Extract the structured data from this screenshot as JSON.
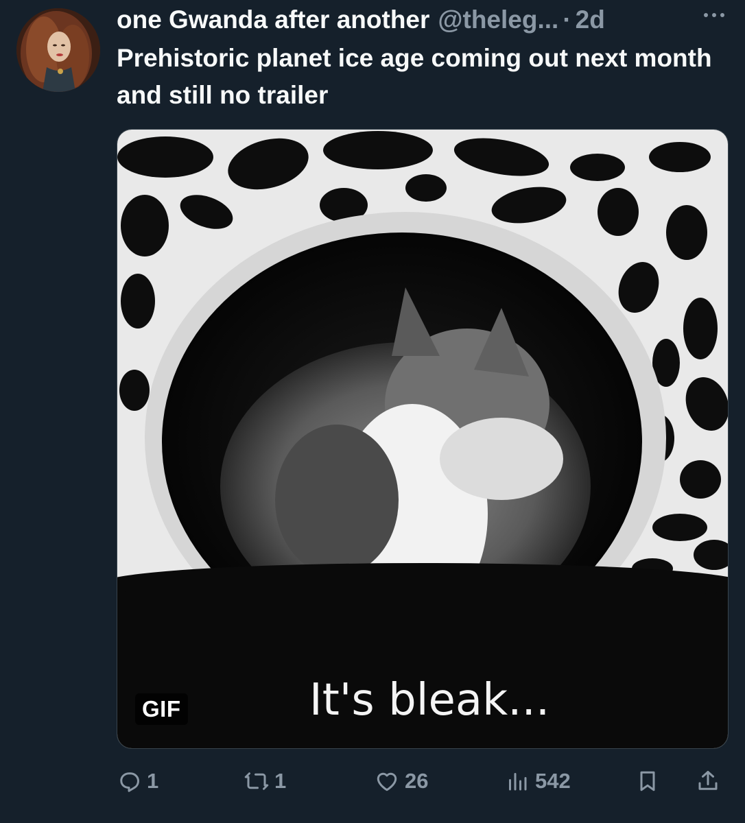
{
  "tweet": {
    "display_name": "one Gwanda after another",
    "handle": "@theleg...",
    "separator": "·",
    "time": "2d",
    "text": "Prehistoric planet ice age coming out next month and still no trailer",
    "avatar_icon": "profile-photo",
    "more_icon": "more-dots-icon"
  },
  "media": {
    "badge": "GIF",
    "caption": "It's bleak..."
  },
  "actions": {
    "replies": "1",
    "reposts": "1",
    "likes": "26",
    "views": "542"
  },
  "colors": {
    "background": "#15202b",
    "text": "#f7f9f9",
    "secondary": "#8b98a5",
    "border": "#38444d"
  }
}
